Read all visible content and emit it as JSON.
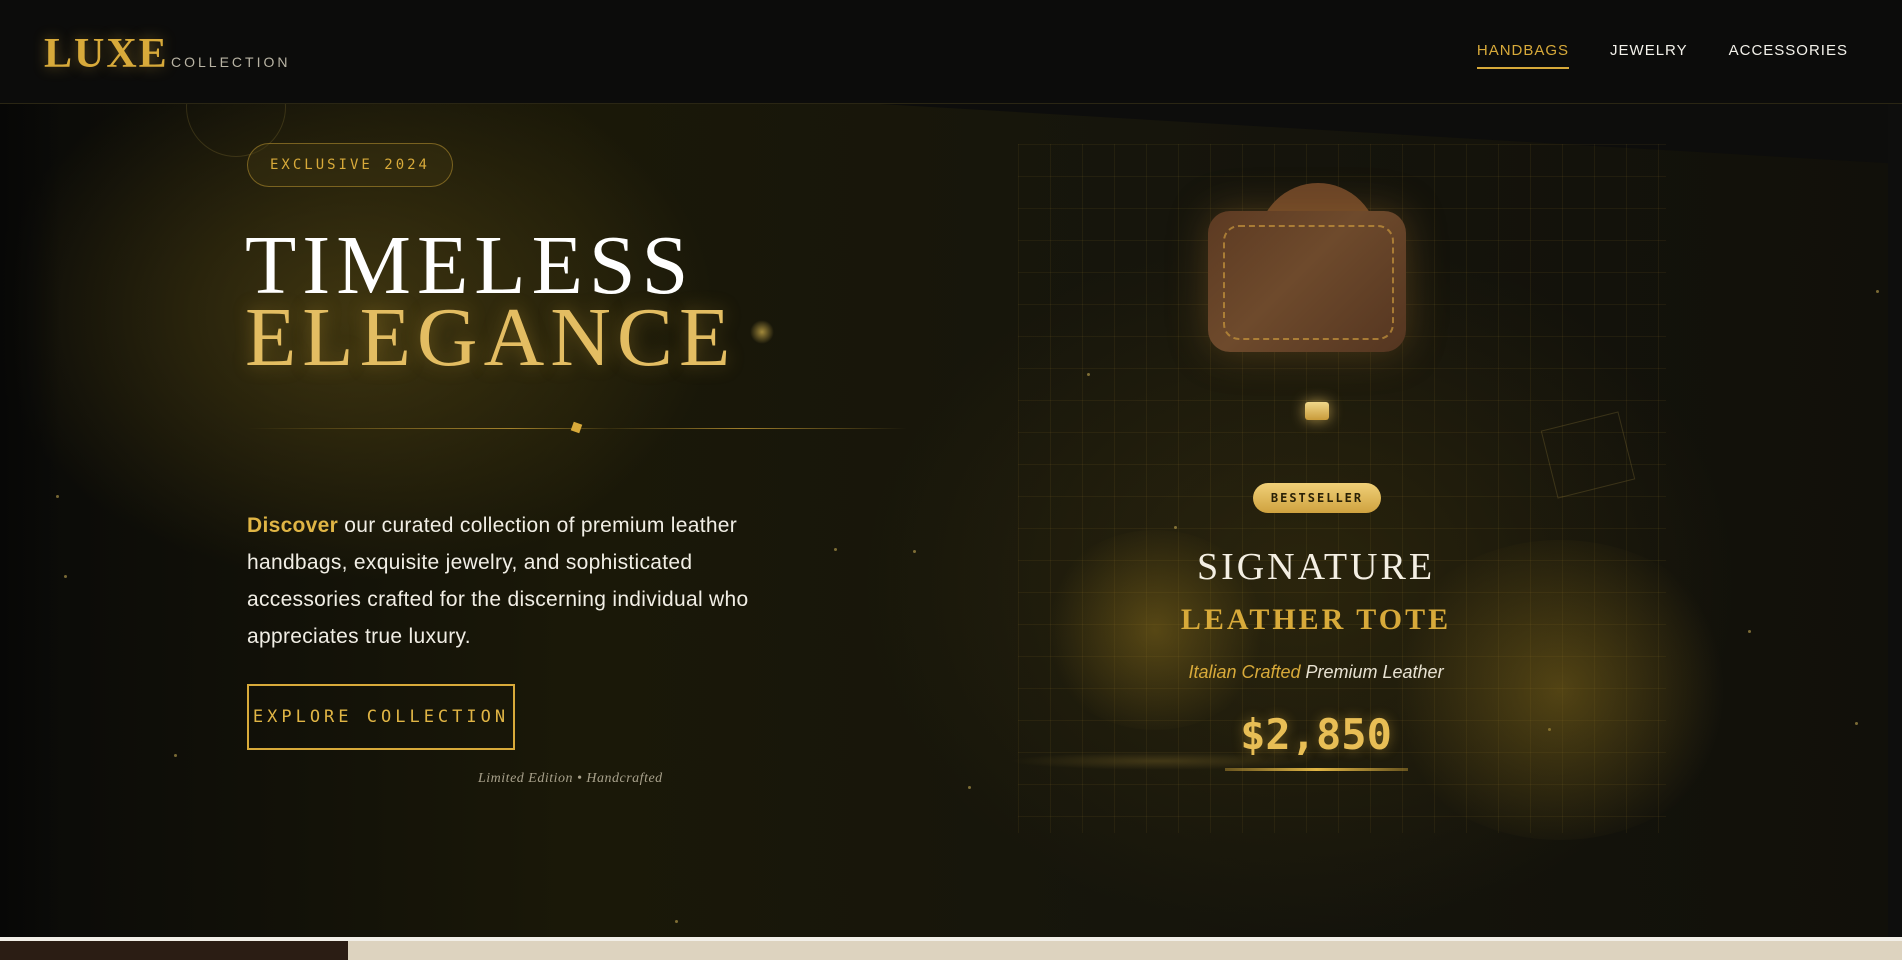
{
  "header": {
    "logo": "LUXE",
    "logo_sub": "COLLECTION",
    "nav": [
      {
        "label": "HANDBAGS",
        "active": true
      },
      {
        "label": "JEWELRY",
        "active": false
      },
      {
        "label": "ACCESSORIES",
        "active": false
      }
    ]
  },
  "hero": {
    "badge": "EXCLUSIVE 2024",
    "title_line1": "TIMELESS",
    "title_line2": "ELEGANCE",
    "description_highlight": "Discover",
    "description_rest": " our curated collection of premium leather handbags, exquisite jewelry, and sophisticated accessories crafted for the discerning individual who appreciates true luxury.",
    "cta_label": "EXPLORE COLLECTION",
    "footnote": "Limited Edition • Handcrafted"
  },
  "product": {
    "badge": "BESTSELLER",
    "title_line1": "SIGNATURE",
    "title_line2": "LEATHER TOTE",
    "subtitle_highlight": "Italian Crafted",
    "subtitle_rest": " Premium Leather",
    "price": "$2,850",
    "icon": "handbag-icon"
  },
  "colors": {
    "accent_gold": "#d8aa3a",
    "background": "#0b0b0a",
    "leather_brown": "#5c3a22"
  }
}
